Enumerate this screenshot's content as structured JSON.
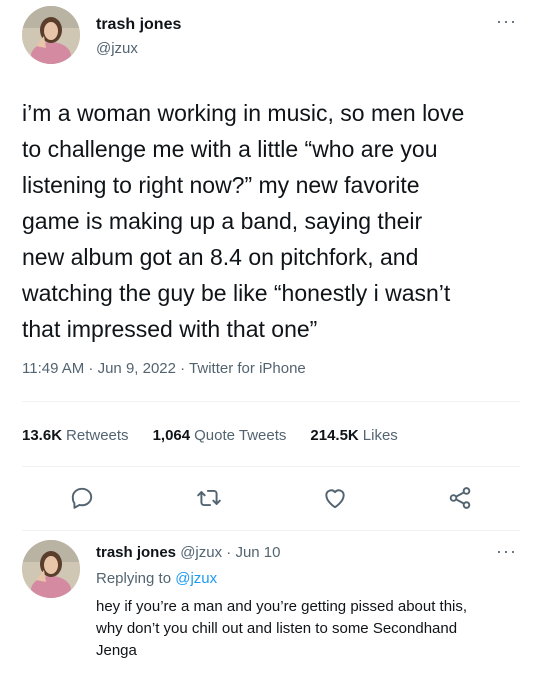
{
  "tweet": {
    "author_name": "trash jones",
    "author_handle": "@jzux",
    "more_label": "···",
    "text": "i’m a woman working in music, so men love\nto challenge me with a little “who are you\nlistening to right now?” my new favorite\ngame is making up a band, saying their\nnew album got an 8.4 on pitchfork, and\nwatching the guy be like “honestly i wasn’t\nthat impressed with that one”",
    "meta": "11:49 AM · Jun 9, 2022 · Twitter for iPhone",
    "stats": {
      "retweets_count": "13.6K",
      "retweets_label": "Retweets",
      "quotes_count": "1,064",
      "quotes_label": "Quote Tweets",
      "likes_count": "214.5K",
      "likes_label": "Likes"
    }
  },
  "reply": {
    "author_name": "trash jones",
    "author_handle": "@jzux",
    "separator": "·",
    "date": "Jun 10",
    "more_label": "···",
    "replying_prefix": "Replying to",
    "replying_handle": "@jzux",
    "text": "hey if you’re a man and you’re getting pissed about this,\nwhy don’t you chill out and listen to some Secondhand\nJenga"
  },
  "icons": {
    "reply": "reply-icon",
    "retweet": "retweet-icon",
    "like": "like-icon",
    "share": "share-icon"
  },
  "colors": {
    "text": "#0f1419",
    "secondary": "#536471",
    "link": "#1d9bf0",
    "divider": "#eff3f4"
  }
}
